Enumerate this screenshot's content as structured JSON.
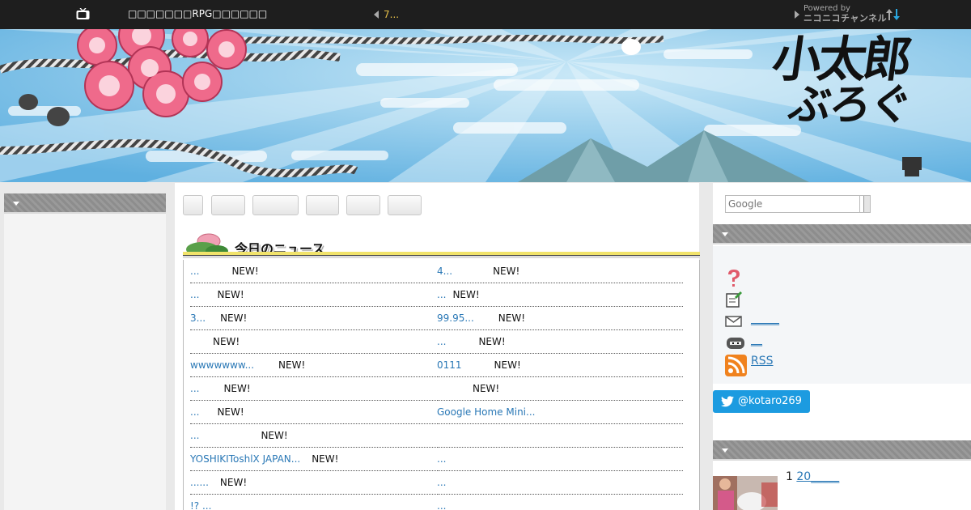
{
  "topbar": {
    "title": "□□□□□□□RPG□□□□□□",
    "news_ticker": "7...",
    "powered_by": "Powered by",
    "brand": "ニコニコチャンネル"
  },
  "header": {
    "logo_line1": "小太郎",
    "logo_line2": "ぶろぐ"
  },
  "nav_tabs": [
    "",
    "",
    "",
    "",
    "",
    ""
  ],
  "news": {
    "title": "今日のニュース",
    "left": [
      {
        "link": "...",
        "badge": "NEW!"
      },
      {
        "link": "...",
        "badge": "NEW!"
      },
      {
        "link": "3...",
        "badge": "NEW!"
      },
      {
        "link": "",
        "badge": "NEW!"
      },
      {
        "link": "wwwwwww...",
        "badge": "NEW!"
      },
      {
        "link": " ...",
        "badge": "NEW!"
      },
      {
        "link": "...",
        "badge": "NEW!"
      },
      {
        "link": "...",
        "badge": "NEW!"
      },
      {
        "link": "YOSHIKIToshlX JAPAN...",
        "badge": "NEW!"
      },
      {
        "link": "......",
        "badge": "NEW!"
      },
      {
        "link": "!? ...",
        "badge": ""
      }
    ],
    "right": [
      {
        "link": "4...",
        "badge": "NEW!"
      },
      {
        "link": "...",
        "badge": "NEW!"
      },
      {
        "link": "99.95...",
        "badge": "NEW!"
      },
      {
        "link": "...",
        "badge": "NEW!"
      },
      {
        "link": "0111",
        "badge": "NEW!"
      },
      {
        "link": "",
        "badge": "NEW!"
      },
      {
        "link": "Google Home Mini...",
        "badge": ""
      },
      {
        "link": "",
        "badge": ""
      },
      {
        "link": "...",
        "badge": ""
      },
      {
        "link": " ...",
        "badge": ""
      },
      {
        "link": "...",
        "badge": ""
      }
    ]
  },
  "sidebar_right": {
    "search_placeholder": "Google",
    "links": [
      {
        "icon": "question-icon",
        "label": ""
      },
      {
        "icon": "edit-note-icon",
        "label": ""
      },
      {
        "icon": "mail-icon",
        "label": "_____"
      },
      {
        "icon": "ninja-icon",
        "label": "__"
      },
      {
        "icon": "rss-icon",
        "label": "RSS"
      }
    ],
    "twitter_handle": "@kotaro269",
    "ranking": {
      "rank": "1",
      "link": "20_____"
    }
  },
  "colors": {
    "topbar": "#1e1e1e",
    "link": "#2a78b6",
    "twitter": "#1c9be0",
    "news_bar": "#f1e36b"
  }
}
